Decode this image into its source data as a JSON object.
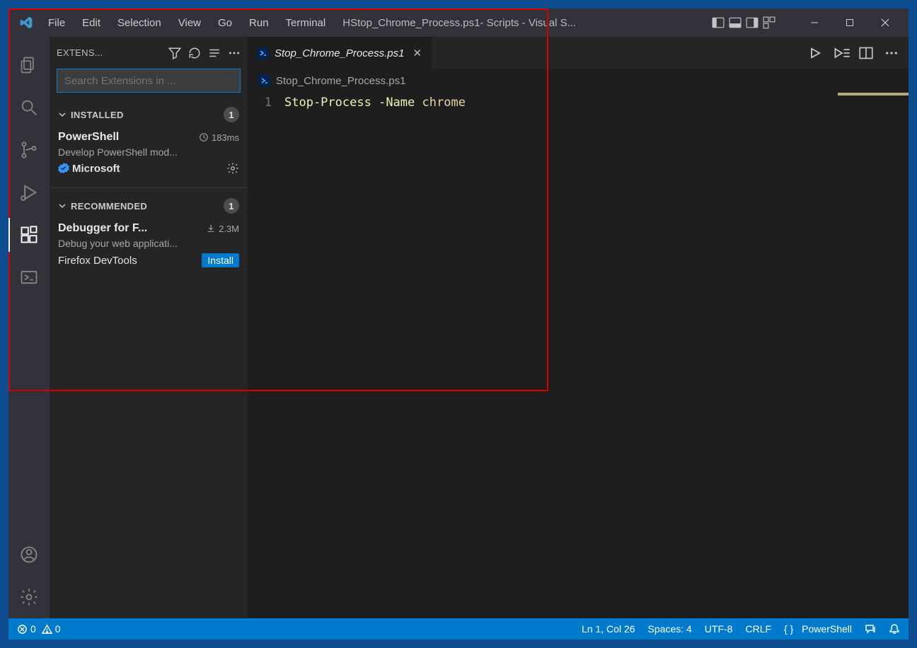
{
  "menu": [
    "File",
    "Edit",
    "Selection",
    "View",
    "Go",
    "Run",
    "Terminal"
  ],
  "title_file": "HStop_Chrome_Process.ps1",
  "title_suffix": " - Scripts - Visual S...",
  "sidebar": {
    "title": "EXTENS...",
    "search_placeholder": "Search Extensions in ...",
    "installed": {
      "label": "INSTALLED",
      "count": "1",
      "ext": {
        "name": "PowerShell",
        "timing": "183ms",
        "desc": "Develop PowerShell mod...",
        "publisher": "Microsoft"
      }
    },
    "recommended": {
      "label": "RECOMMENDED",
      "count": "1",
      "ext": {
        "name": "Debugger for F...",
        "downloads": "2.3M",
        "desc": "Debug your web applicati...",
        "publisher": "Firefox DevTools",
        "install": "Install"
      }
    }
  },
  "editor": {
    "tab_name": "Stop_Chrome_Process.ps1",
    "breadcrumb": "Stop_Chrome_Process.ps1",
    "line_number": "1",
    "code": {
      "cmd": "Stop-Process",
      "param": "-Name",
      "arg": "chrome"
    }
  },
  "statusbar": {
    "errors": "0",
    "warnings": "0",
    "ln_col": "Ln 1, Col 26",
    "spaces": "Spaces: 4",
    "encoding": "UTF-8",
    "eol": "CRLF",
    "lang": "PowerShell"
  }
}
